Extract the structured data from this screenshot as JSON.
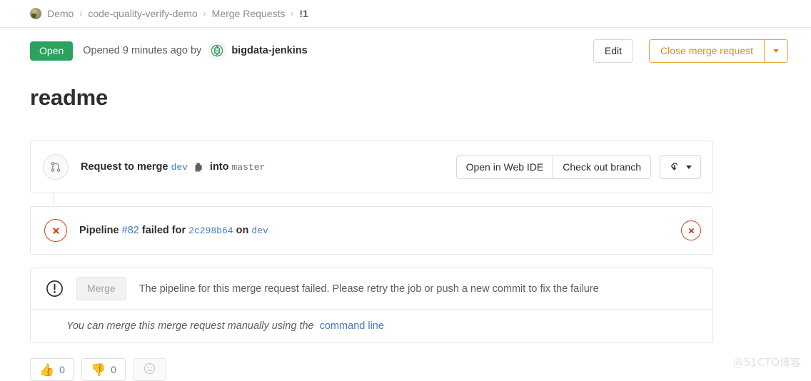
{
  "breadcrumb": {
    "items": [
      {
        "label": "Demo",
        "strong": false
      },
      {
        "label": "code-quality-verify-demo",
        "strong": false
      },
      {
        "label": "Merge Requests",
        "strong": false
      },
      {
        "label": "!1",
        "strong": true
      }
    ],
    "separator": "›",
    "avatar_icon": "project-avatar-icon"
  },
  "status": {
    "badge": "Open",
    "badge_color": "#2ca25f",
    "opened_text": "Opened 9 minutes ago by",
    "author": "bigdata-jenkins",
    "author_avatar_icon": "jenkins-avatar-icon",
    "edit_label": "Edit",
    "close_label": "Close merge request",
    "close_caret_icon": "chevron-down-icon",
    "close_accent": "#e8a33d"
  },
  "title": "readme",
  "merge_widget": {
    "icon": "merge-request-icon",
    "prefix": "Request to merge",
    "source_branch": "dev",
    "copy_icon": "copy-icon",
    "middle": "into",
    "target_branch": "master",
    "web_ide_label": "Open in Web IDE",
    "checkout_label": "Check out branch",
    "download_icon": "download-code-icon",
    "download_caret_icon": "chevron-down-icon"
  },
  "pipeline": {
    "status_icon": "pipeline-failed-icon",
    "prefix": "Pipeline",
    "number": "#82",
    "middle": "failed for",
    "commit": "2c298b64",
    "on_label": "on",
    "branch": "dev",
    "dismiss_icon": "dismiss-failed-icon",
    "fail_color": "#db3b21"
  },
  "merge_section": {
    "warn_icon": "warning-circle-icon",
    "merge_button": "Merge",
    "message": "The pipeline for this merge request failed. Please retry the job or push a new commit to fix the failure",
    "manual_prefix": "You can merge this merge request manually using the",
    "manual_link": "command line"
  },
  "reactions": [
    {
      "name": "thumbs-up",
      "emoji": "👍",
      "count": "0"
    },
    {
      "name": "thumbs-down",
      "emoji": "👎",
      "count": "0"
    }
  ],
  "add_reaction_icon": "smiley-add-reaction-icon",
  "watermark": "@51CTO博客"
}
